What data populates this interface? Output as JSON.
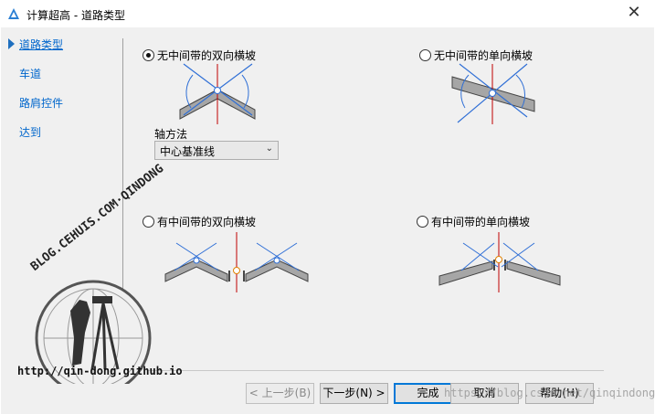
{
  "window": {
    "title": "计算超高 - 道路类型",
    "close_glyph": "✕"
  },
  "sidebar": {
    "items": [
      {
        "label": "道路类型"
      },
      {
        "label": "车道"
      },
      {
        "label": "路肩控件"
      },
      {
        "label": "达到"
      }
    ]
  },
  "options": {
    "opt1": {
      "label": "无中间带的双向横坡",
      "checked": true
    },
    "opt2": {
      "label": "无中间带的单向横坡",
      "checked": false
    },
    "opt3": {
      "label": "有中间带的双向横坡",
      "checked": false
    },
    "opt4": {
      "label": "有中间带的单向横坡",
      "checked": false
    }
  },
  "axis": {
    "label": "轴方法",
    "value": "中心基准线"
  },
  "buttons": {
    "back": "< 上一步(B)",
    "next": "下一步(N) >",
    "finish": "完成",
    "cancel": "取消",
    "help": "帮助(H)"
  },
  "watermark": {
    "arc_text": "BLOG.CEHUIS.COM·QINDONG",
    "url": "http://qin-dong.github.io",
    "csdn": "https://blog.csdn.net/qinqindong"
  },
  "colors": {
    "accent": "#0066cc",
    "road": "#a6a6a6",
    "lines": "#2f6fd6",
    "axis": "#c00000"
  }
}
